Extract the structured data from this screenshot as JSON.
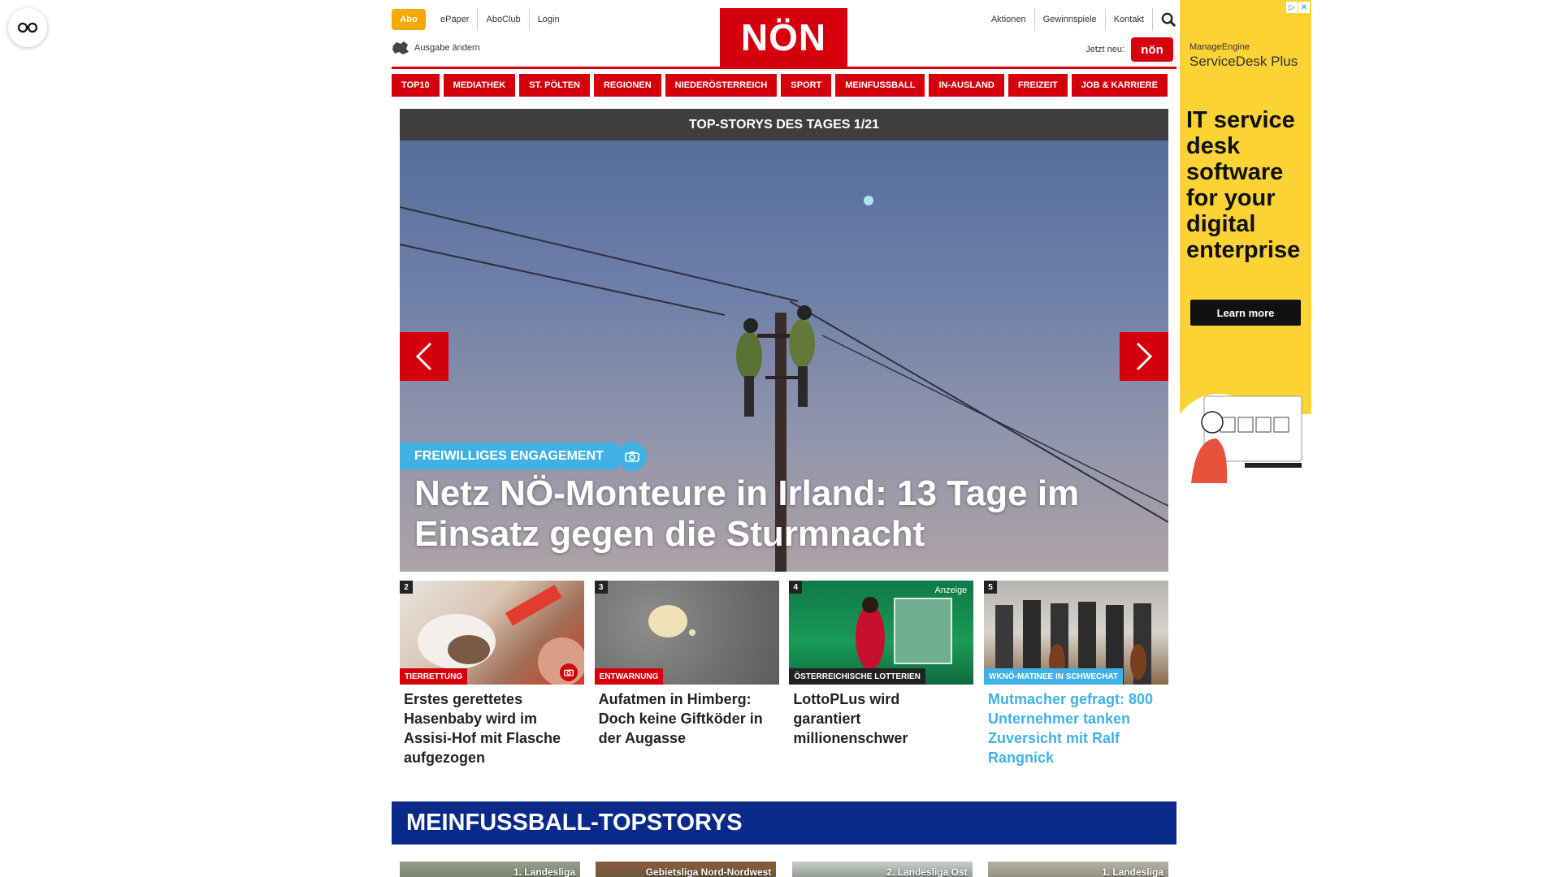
{
  "header": {
    "abo_label": "Abo",
    "top_links": [
      "ePaper",
      "AboClub",
      "Login"
    ],
    "right_links": [
      "Aktionen",
      "Gewinnspiele",
      "Kontakt"
    ],
    "logo_text": "NÖN",
    "edition_label": "Ausgabe ändern",
    "jetzt_label": "Jetzt neu:",
    "jetzt_badge": "nön"
  },
  "nav": [
    "TOP10",
    "MEDIATHEK",
    "ST. PÖLTEN",
    "REGIONEN",
    "NIEDERÖSTERREICH",
    "SPORT",
    "MEINFUSSBALL",
    "IN-AUSLAND",
    "FREIZEIT",
    "JOB & KARRIERE"
  ],
  "carousel": {
    "heading": "TOP-STORYS DES TAGES 1/21",
    "tag": "FREIWILLIGES ENGAGEMENT",
    "title": "Netz NÖ-Monteure in Irland: 13 Tage im Einsatz gegen die Sturmnacht"
  },
  "teasers": [
    {
      "num": "2",
      "badge": "TIERRETTUNG",
      "title": "Erstes gerettetes Hasenbaby wird im Assisi-Hof mit Flasche aufgezogen"
    },
    {
      "num": "3",
      "badge": "ENTWARNUNG",
      "title": "Aufatmen in Himberg: Doch keine Giftköder in der Augasse"
    },
    {
      "num": "4",
      "badge": "ÖSTERREICHISCHE LOTTERIEN",
      "anzeige": "Anzeige",
      "title": "LottoPLus wird garantiert millionenschwer"
    },
    {
      "num": "5",
      "badge": "WKNÖ-MATINEE IN SCHWECHAT",
      "title": "Mutmacher gefragt: 800 Unternehmer tanken Zuversicht mit Ralf Rangnick"
    }
  ],
  "fussball": {
    "heading": "MEINFUSSBALL-TOPSTORYS",
    "items": [
      "1. Landesliga",
      "Gebietsliga Nord-Nordwest",
      "2. Landesliga Ost",
      "1. Landesliga"
    ]
  },
  "ad": {
    "brand_small": "ManageEngine",
    "brand": "ServiceDesk Plus",
    "headline": "IT service desk software for your digital enterprise",
    "cta": "Learn more"
  },
  "colors": {
    "brand_red": "#d6000c",
    "accent_blue": "#3fb1e5",
    "fussball_blue": "#0a2a8a",
    "abo_orange": "#f5a800",
    "ad_yellow": "#fbd334"
  }
}
